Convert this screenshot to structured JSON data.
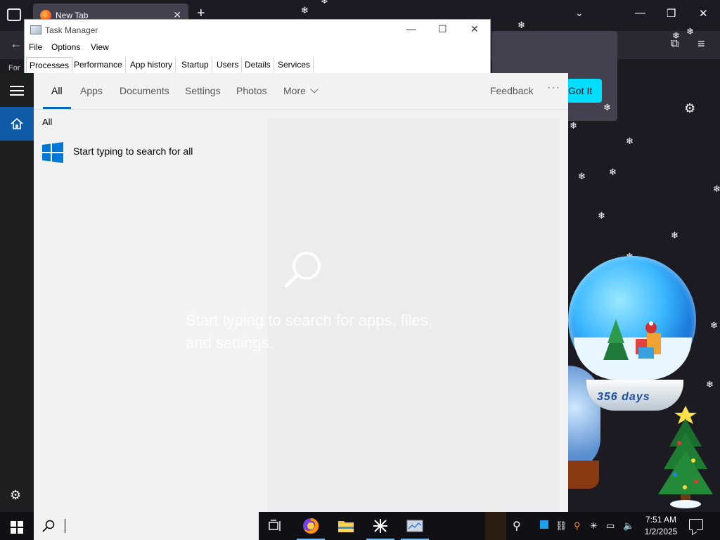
{
  "browser": {
    "tab_title": "New Tab",
    "tab_close": "✕",
    "new_tab": "+",
    "all_tabs": "⌄",
    "minimize": "—",
    "maximize": "❐",
    "close": "✕",
    "back": "←",
    "bookmark_stub": "For",
    "got_it": "Got It",
    "extensions": "⧉",
    "menu": "≡",
    "settings": "⚙"
  },
  "decor": {
    "globe_text": "356 days"
  },
  "task_manager": {
    "title": "Task Manager",
    "minimize": "—",
    "maximize": "☐",
    "close": "✕",
    "menu": [
      "File",
      "Options",
      "View"
    ],
    "tabs": [
      "Processes",
      "Performance",
      "App history",
      "Startup",
      "Users",
      "Details",
      "Services"
    ],
    "active_tab": "Processes"
  },
  "search": {
    "tabs": [
      "All",
      "Apps",
      "Documents",
      "Settings",
      "Photos",
      "More"
    ],
    "active_tab": "All",
    "feedback": "Feedback",
    "more_options": "···",
    "section_heading": "All",
    "hint": "Start typing to search for all",
    "empty_state": "Start typing to search for apps, files, and settings.",
    "input_value": ""
  },
  "rail": {
    "settings": "⚙"
  },
  "taskbar": {
    "time": "7:51 AM",
    "date": "1/2/2025",
    "apps": [
      "task-view",
      "firefox",
      "file-explorer",
      "snipping-tool",
      "task-manager"
    ]
  },
  "colors": {
    "accent": "#0067c0",
    "search_bg": "#f2f2f2",
    "got_it": "#00ddff",
    "taskbar": "#101015"
  }
}
